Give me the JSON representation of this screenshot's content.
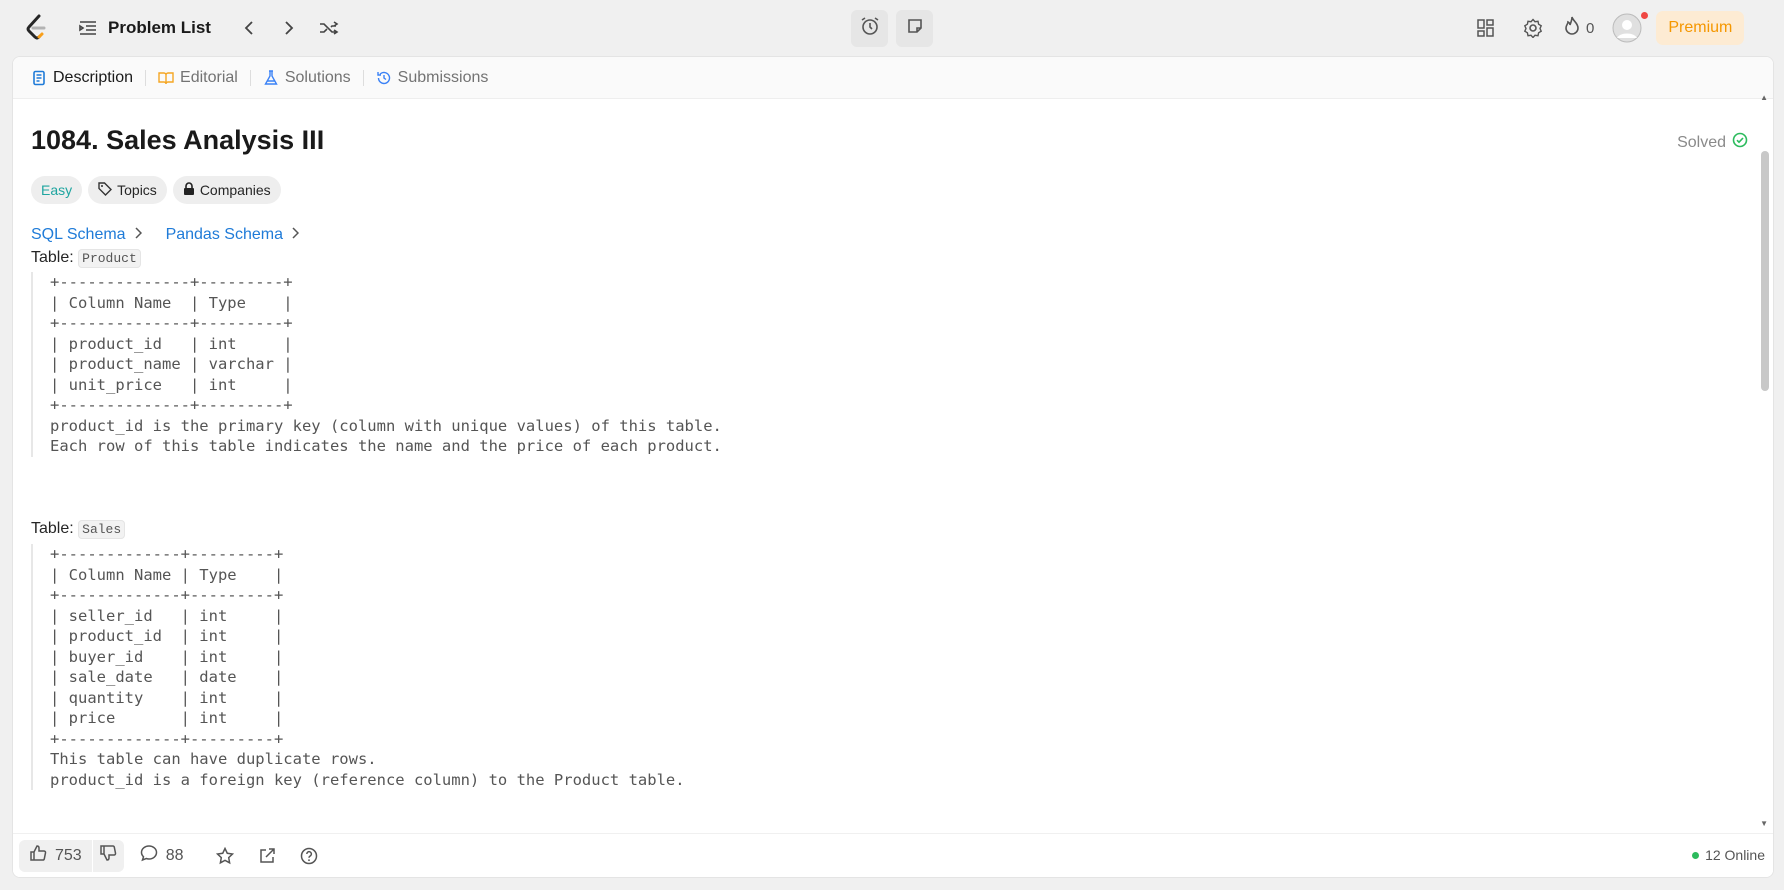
{
  "header": {
    "problem_list_label": "Problem List",
    "streak_count": "0",
    "premium_label": "Premium"
  },
  "tabs": [
    {
      "label": "Description"
    },
    {
      "label": "Editorial"
    },
    {
      "label": "Solutions"
    },
    {
      "label": "Submissions"
    }
  ],
  "problem": {
    "title": "1084. Sales Analysis III",
    "status": "Solved",
    "difficulty": "Easy",
    "topics_label": "Topics",
    "companies_label": "Companies",
    "sql_schema": "SQL Schema",
    "pandas_schema": "Pandas Schema",
    "table_prefix": "Table:",
    "table1_name": "Product",
    "table1_schema": "+--------------+---------+\n| Column Name  | Type    |\n+--------------+---------+\n| product_id   | int     |\n| product_name | varchar |\n| unit_price   | int     |\n+--------------+---------+\nproduct_id is the primary key (column with unique values) of this table.\nEach row of this table indicates the name and the price of each product.",
    "table2_name": "Sales",
    "table2_schema": "+-------------+---------+\n| Column Name | Type    |\n+-------------+---------+\n| seller_id   | int     |\n| product_id  | int     |\n| buyer_id    | int     |\n| sale_date   | date    |\n| quantity    | int     |\n| price       | int     |\n+-------------+---------+\nThis table can have duplicate rows.\nproduct_id is a foreign key (reference column) to the Product table."
  },
  "footer": {
    "likes": "753",
    "comments": "88",
    "online": "12 Online"
  },
  "colors": {
    "accent_premium": "#f59700",
    "easy": "#1fa5a0",
    "link": "#1f7bd8",
    "solved_check": "#2cbb5d"
  }
}
